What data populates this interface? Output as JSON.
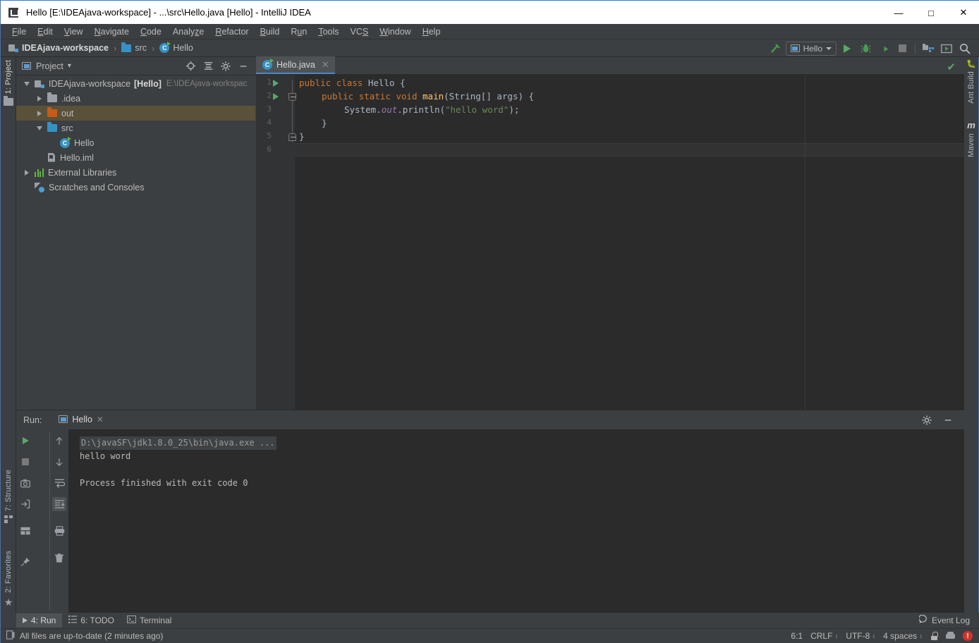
{
  "window": {
    "title": "Hello [E:\\IDEAjava-workspace] - ...\\src\\Hello.java [Hello] - IntelliJ IDEA",
    "app_icon": "intellij-idea-icon",
    "minimize": "—",
    "maximize": "□",
    "close": "✕"
  },
  "menubar": {
    "items": [
      {
        "label": "File",
        "mnemonic": "F"
      },
      {
        "label": "Edit",
        "mnemonic": "E"
      },
      {
        "label": "View",
        "mnemonic": "V"
      },
      {
        "label": "Navigate",
        "mnemonic": "N"
      },
      {
        "label": "Code",
        "mnemonic": "C"
      },
      {
        "label": "Analyze",
        "mnemonic": "z"
      },
      {
        "label": "Refactor",
        "mnemonic": "R"
      },
      {
        "label": "Build",
        "mnemonic": "B"
      },
      {
        "label": "Run",
        "mnemonic": "u"
      },
      {
        "label": "Tools",
        "mnemonic": "T"
      },
      {
        "label": "VCS",
        "mnemonic": "S"
      },
      {
        "label": "Window",
        "mnemonic": "W"
      },
      {
        "label": "Help",
        "mnemonic": "H"
      }
    ]
  },
  "navbar": {
    "crumbs": [
      {
        "label": "IDEAjava-workspace",
        "icon": "module-icon",
        "bold": true
      },
      {
        "label": "src",
        "icon": "folder-icon",
        "bold": false
      },
      {
        "label": "Hello",
        "icon": "java-class-icon",
        "bold": false
      }
    ],
    "separator": "›"
  },
  "toolbar": {
    "build_icon": "hammer-icon",
    "run_config": "Hello",
    "run_config_icon": "run-config-icon",
    "buttons": [
      {
        "name": "run-button",
        "icon": "play-icon"
      },
      {
        "name": "debug-button",
        "icon": "bug-icon"
      },
      {
        "name": "run-with-coverage-button",
        "icon": "coverage-icon"
      },
      {
        "name": "stop-button",
        "icon": "stop-icon"
      },
      {
        "name": "project-structure-button",
        "icon": "project-structure-icon"
      },
      {
        "name": "update-project-button",
        "icon": "terminal-box-icon"
      },
      {
        "name": "search-everywhere-button",
        "icon": "search-icon"
      }
    ]
  },
  "left_stripe": {
    "items": [
      {
        "label": "1: Project",
        "selected": true,
        "icon": "folder-icon"
      },
      {
        "label": "7: Structure",
        "selected": false,
        "icon": "structure-icon"
      },
      {
        "label": "2: Favorites",
        "selected": false,
        "icon": "star-icon"
      }
    ]
  },
  "right_stripe": {
    "items": [
      {
        "label": "Ant Build",
        "icon": "ant-icon"
      },
      {
        "label": "Maven",
        "icon": "maven-icon"
      }
    ]
  },
  "project_panel": {
    "title": "Project",
    "dropdown_caret": "▾",
    "header_buttons": [
      {
        "name": "locate-button",
        "icon": "crosshair-icon"
      },
      {
        "name": "collapse-all-button",
        "icon": "collapse-all-icon"
      },
      {
        "name": "settings-button",
        "icon": "gear-icon"
      },
      {
        "name": "hide-button",
        "icon": "minimize-icon"
      }
    ],
    "tree": [
      {
        "label": "IDEAjava-workspace",
        "badge": "[Hello]",
        "path": "E:\\IDEAjava-workspac",
        "icon": "module-icon",
        "depth": 0,
        "expanded": true,
        "selected": false
      },
      {
        "label": ".idea",
        "icon": "folder-grey-icon",
        "depth": 1,
        "expanded": false,
        "selected": false
      },
      {
        "label": "out",
        "icon": "folder-orange-icon",
        "depth": 1,
        "expanded": false,
        "selected": true
      },
      {
        "label": "src",
        "icon": "folder-blue-icon",
        "depth": 1,
        "expanded": true,
        "selected": false
      },
      {
        "label": "Hello",
        "icon": "java-class-icon",
        "depth": 2,
        "leaf": true,
        "selected": false
      },
      {
        "label": "Hello.iml",
        "icon": "iml-file-icon",
        "depth": 1,
        "leaf": true,
        "selected": false
      },
      {
        "label": "External Libraries",
        "icon": "library-icon",
        "depth": 0,
        "expanded": false,
        "selected": false
      },
      {
        "label": "Scratches and Consoles",
        "icon": "scratches-icon",
        "depth": 0,
        "leaf": true,
        "selected": false
      }
    ]
  },
  "editor": {
    "tab": {
      "label": "Hello.java",
      "icon": "java-class-icon",
      "close": "✕"
    },
    "inspection_status": "✔",
    "line_numbers": [
      "1",
      "2",
      "3",
      "4",
      "5",
      "6"
    ],
    "current_line": 6,
    "code_lines": [
      {
        "n": 1,
        "indent": 0,
        "tokens": [
          {
            "t": "public ",
            "c": "kw"
          },
          {
            "t": "class ",
            "c": "kw"
          },
          {
            "t": "Hello ",
            "c": "cls"
          },
          {
            "t": "{",
            "c": "pln"
          }
        ]
      },
      {
        "n": 2,
        "indent": 1,
        "tokens": [
          {
            "t": "public ",
            "c": "kw"
          },
          {
            "t": "static ",
            "c": "kw"
          },
          {
            "t": "void ",
            "c": "kw"
          },
          {
            "t": "main",
            "c": "mth"
          },
          {
            "t": "(String[] args) {",
            "c": "pln"
          }
        ]
      },
      {
        "n": 3,
        "indent": 2,
        "tokens": [
          {
            "t": "System.",
            "c": "pln"
          },
          {
            "t": "out",
            "c": "fld"
          },
          {
            "t": ".println(",
            "c": "pln"
          },
          {
            "t": "\"hello word\"",
            "c": "str"
          },
          {
            "t": ");",
            "c": "pln"
          }
        ]
      },
      {
        "n": 4,
        "indent": 1,
        "tokens": [
          {
            "t": "}",
            "c": "pln"
          }
        ]
      },
      {
        "n": 5,
        "indent": 0,
        "tokens": [
          {
            "t": "}",
            "c": "pln"
          }
        ]
      },
      {
        "n": 6,
        "indent": 0,
        "tokens": []
      }
    ],
    "gutter_run_marks": [
      1,
      2
    ]
  },
  "run_panel": {
    "label": "Run:",
    "tab": {
      "label": "Hello",
      "icon": "run-config-icon",
      "close": "✕"
    },
    "header_buttons": [
      {
        "name": "settings-button",
        "icon": "gear-icon"
      },
      {
        "name": "hide-button",
        "icon": "minimize-icon"
      }
    ],
    "tools_left": [
      {
        "name": "rerun-button",
        "icon": "play-icon"
      },
      {
        "name": "stop-button",
        "icon": "stop-icon"
      },
      {
        "name": "screenshot-button",
        "icon": "camera-icon"
      },
      {
        "name": "export-button",
        "icon": "import-arrow-icon"
      },
      {
        "name": "layout-button",
        "icon": "layout-icon"
      },
      {
        "name": "pin-tab-button",
        "icon": "pin-icon"
      }
    ],
    "tools_right": [
      {
        "name": "up-stack-button",
        "icon": "arrow-up-icon"
      },
      {
        "name": "down-stack-button",
        "icon": "arrow-down-icon"
      },
      {
        "name": "soft-wrap-button",
        "icon": "soft-wrap-icon"
      },
      {
        "name": "scroll-to-end-button",
        "icon": "scroll-end-icon",
        "active": true
      },
      {
        "name": "print-button",
        "icon": "printer-icon"
      },
      {
        "name": "clear-all-button",
        "icon": "trash-icon"
      }
    ],
    "console": [
      {
        "text": "D:\\javaSF\\jdk1.8.0_25\\bin\\java.exe ...",
        "kind": "cmd"
      },
      {
        "text": "hello word",
        "kind": "out"
      },
      {
        "text": "",
        "kind": "out"
      },
      {
        "text": "Process finished with exit code 0",
        "kind": "out"
      }
    ]
  },
  "bottom_stripe": {
    "items": [
      {
        "label": "4: Run",
        "mnemonic": "4",
        "icon": "play-icon",
        "selected": true
      },
      {
        "label": "6: TODO",
        "mnemonic": "6",
        "icon": "todo-list-icon",
        "selected": false
      },
      {
        "label": "Terminal",
        "mnemonic": "",
        "icon": "terminal-icon",
        "selected": false
      }
    ]
  },
  "status_bar": {
    "message": "All files are up-to-date (2 minutes ago)",
    "message_icon": "file-sync-icon",
    "event_log": "Event Log",
    "event_log_icon": "balloon-icon",
    "caret_position": "6:1",
    "line_separator": "CRLF",
    "encoding": "UTF-8",
    "indent": "4 spaces",
    "lock_icon": "unlocked-icon",
    "hector_icon": "hector-icon",
    "error_badge": "!"
  },
  "colors": {
    "chrome": "#3c3f41",
    "editor_bg": "#2b2b2b",
    "accent_blue": "#4a88c7",
    "selection": "#5a513a",
    "green": "#59a869",
    "keyword": "#cc7832",
    "string": "#6a8759",
    "method": "#ffc66d",
    "field": "#9876aa",
    "plain": "#a9b7c6"
  }
}
